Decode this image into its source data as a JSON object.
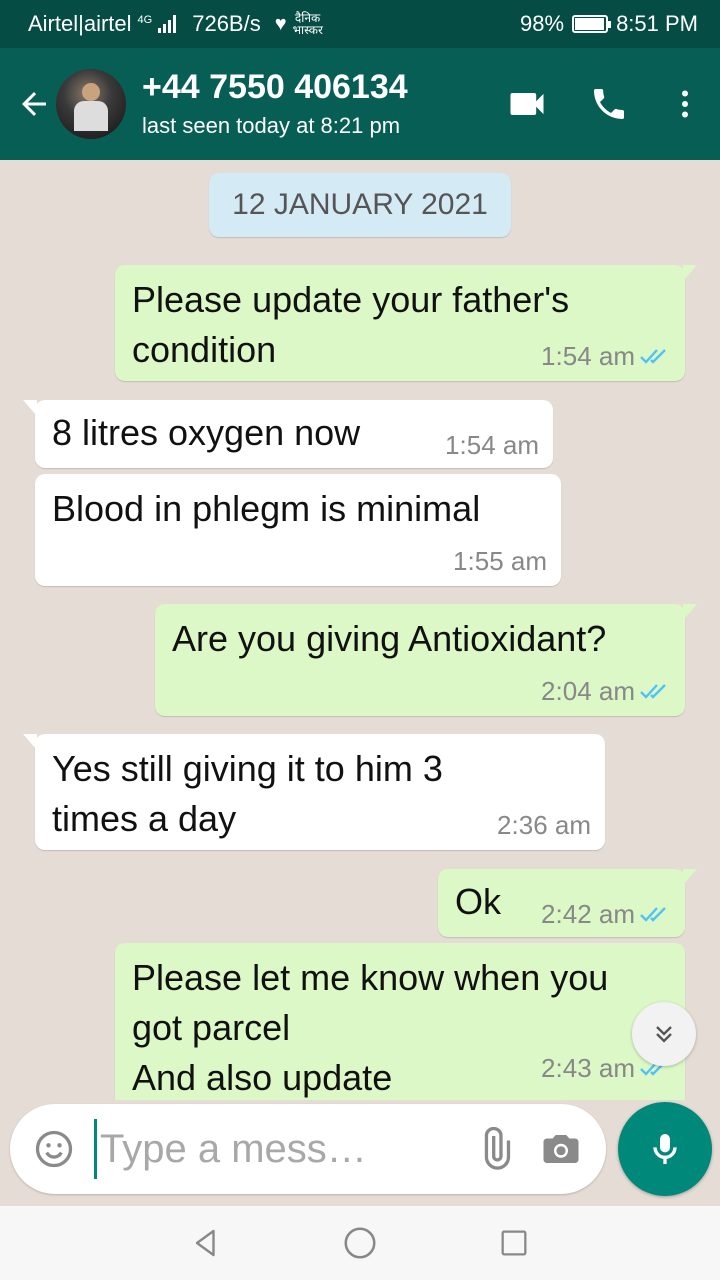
{
  "status_bar": {
    "carrier": "Airtel|airtel",
    "network_type": "4G",
    "speed": "726B/s",
    "news_label": "दैनिक भास्कर",
    "battery_percent": "98%",
    "battery_level": 0.98,
    "time": "8:51 PM"
  },
  "header": {
    "contact_name": "+44 7550 406134",
    "last_seen": "last seen today at 8:21 pm"
  },
  "chat": {
    "date_label": "12 JANUARY 2021",
    "messages": [
      {
        "direction": "out",
        "text": "Please update your father's condition",
        "time": "1:54 am",
        "status": "read"
      },
      {
        "direction": "in",
        "text": "8 litres oxygen now",
        "time": "1:54 am"
      },
      {
        "direction": "in",
        "text": "Blood in phlegm is minimal",
        "time": "1:55 am"
      },
      {
        "direction": "out",
        "text": "Are you giving Antioxidant?",
        "time": "2:04 am",
        "status": "read"
      },
      {
        "direction": "in",
        "text": "Yes still giving it to him 3 times a day",
        "time": "2:36 am"
      },
      {
        "direction": "out",
        "text": "Ok",
        "time": "2:42 am",
        "status": "read"
      },
      {
        "direction": "out",
        "text": "Please let me know when you got parcel\nAnd also update",
        "time": "2:43 am",
        "status": "read"
      }
    ]
  },
  "composer": {
    "placeholder": "Type a mess…"
  },
  "icons": {
    "back": "arrow-left-icon",
    "video": "video-camera-icon",
    "call": "phone-icon",
    "menu": "more-vertical-icon",
    "emoji": "emoji-icon",
    "attach": "paperclip-icon",
    "camera": "camera-icon",
    "mic": "microphone-icon",
    "scroll": "chevron-double-down-icon"
  },
  "colors": {
    "header": "#075e54",
    "status_bar": "#054d44",
    "outgoing_bubble": "#dcf8c6",
    "incoming_bubble": "#ffffff",
    "chat_background": "#e5ddd5",
    "accent": "#00897b",
    "read_tick": "#4fc3f7"
  }
}
